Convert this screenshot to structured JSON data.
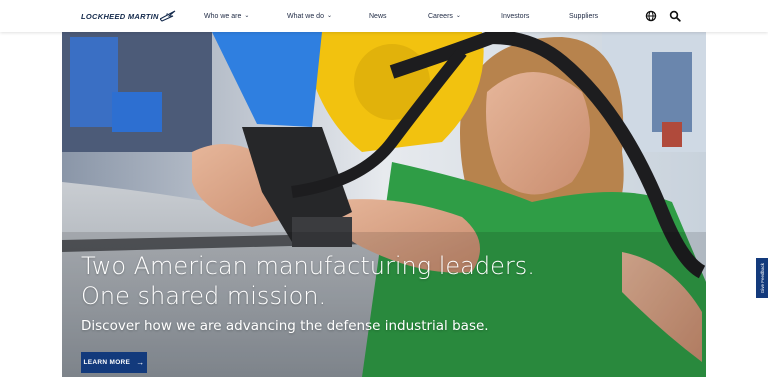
{
  "brand": {
    "name": "LOCKHEED MARTIN",
    "color": "#13294b",
    "accent": "#133a7c"
  },
  "nav": {
    "items": [
      {
        "label": "Who we are",
        "dropdown": true
      },
      {
        "label": "What we do",
        "dropdown": true
      },
      {
        "label": "News",
        "dropdown": false
      },
      {
        "label": "Careers",
        "dropdown": true
      },
      {
        "label": "Investors",
        "dropdown": false
      },
      {
        "label": "Suppliers",
        "dropdown": false
      }
    ],
    "chevron": "⌄",
    "icons": [
      "globe-icon",
      "search-icon"
    ]
  },
  "hero": {
    "headline_line1": "Two American manufacturing leaders.",
    "headline_line2": "One shared mission.",
    "subheadline": "Discover how we are advancing the defense industrial base.",
    "cta_label": "LEARN MORE",
    "cta_arrow": "→"
  },
  "feedback": {
    "label": "Give Feedback"
  }
}
